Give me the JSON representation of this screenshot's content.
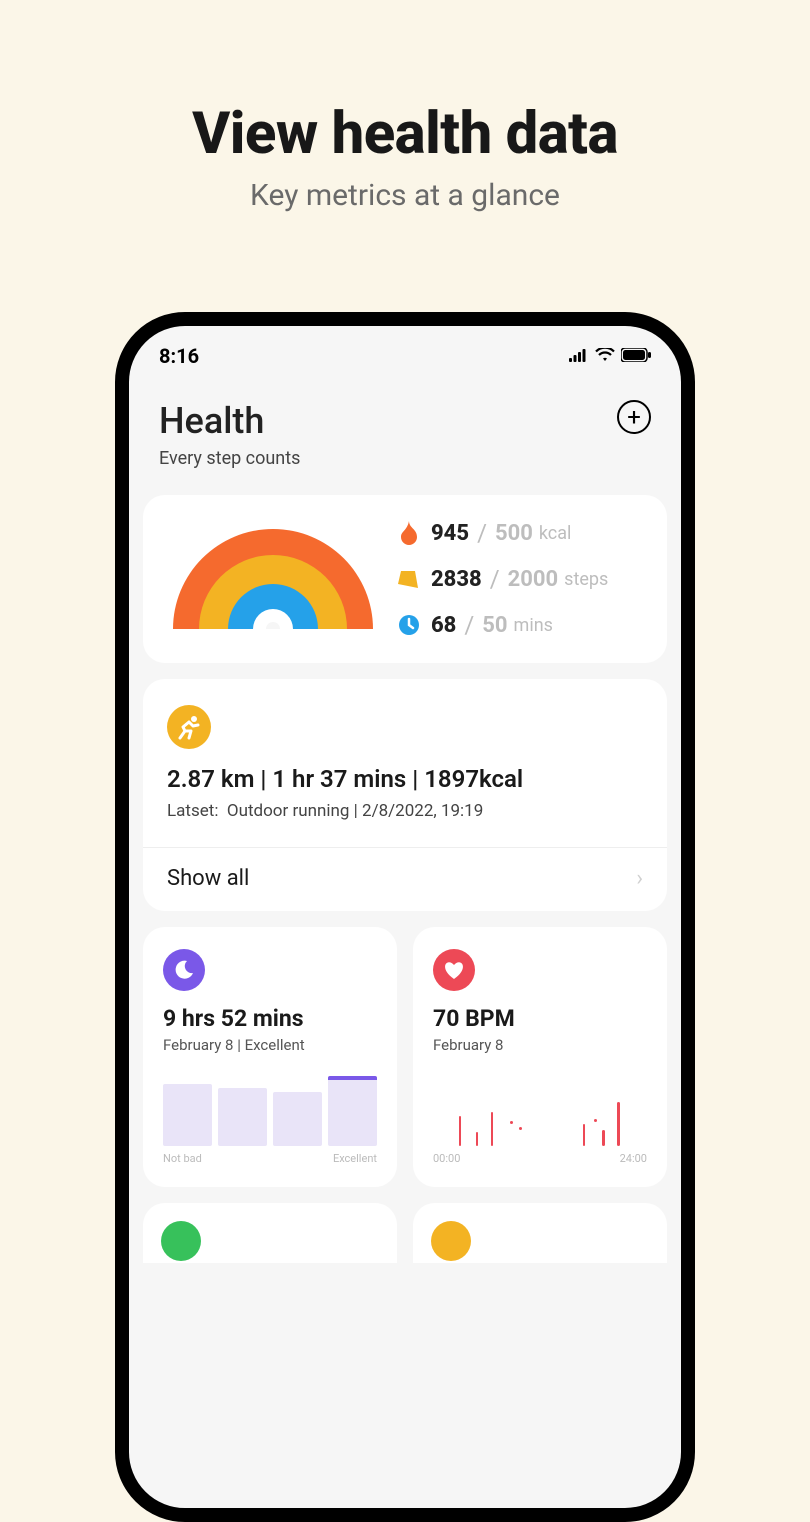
{
  "promo": {
    "title": "View health data",
    "subtitle": "Key metrics at a glance"
  },
  "statusbar": {
    "time": "8:16"
  },
  "header": {
    "title": "Health",
    "subtitle": "Every step counts"
  },
  "activity": {
    "calories": {
      "value": "945",
      "goal": "500",
      "unit": "kcal"
    },
    "steps": {
      "value": "2838",
      "goal": "2000",
      "unit": "steps"
    },
    "minutes": {
      "value": "68",
      "goal": "50",
      "unit": "mins"
    }
  },
  "workout": {
    "summary": "2.87 km | 1 hr 37 mins | 1897kcal",
    "latest_label": "Latset:",
    "latest_type": "Outdoor running",
    "latest_time": "2/8/2022, 19:19",
    "show_all": "Show all"
  },
  "sleep": {
    "value": "9 hrs 52 mins",
    "meta": "February 8 | Excellent",
    "axis_left": "Not bad",
    "axis_right": "Excellent"
  },
  "heart": {
    "value": "70 BPM",
    "meta": "February 8",
    "axis_left": "00:00",
    "axis_right": "24:00"
  },
  "chart_data": [
    {
      "type": "bar",
      "title": "Sleep quality",
      "categories": [
        "",
        "",
        "",
        ""
      ],
      "values": [
        62,
        58,
        54,
        70
      ],
      "xlabel_left": "Not bad",
      "xlabel_right": "Excellent",
      "ylim": [
        0,
        70
      ]
    },
    {
      "type": "scatter",
      "title": "Heart rate over day",
      "x_range": [
        "00:00",
        "24:00"
      ],
      "series": [
        {
          "name": "bpm",
          "points": [
            {
              "x": 0.12,
              "h": 30
            },
            {
              "x": 0.2,
              "h": 14
            },
            {
              "x": 0.27,
              "h": 34
            },
            {
              "x": 0.36,
              "h": 5
            },
            {
              "x": 0.4,
              "h": 6
            },
            {
              "x": 0.7,
              "h": 22
            },
            {
              "x": 0.75,
              "h": 7
            },
            {
              "x": 0.79,
              "h": 16
            },
            {
              "x": 0.86,
              "h": 44
            }
          ]
        }
      ]
    }
  ]
}
